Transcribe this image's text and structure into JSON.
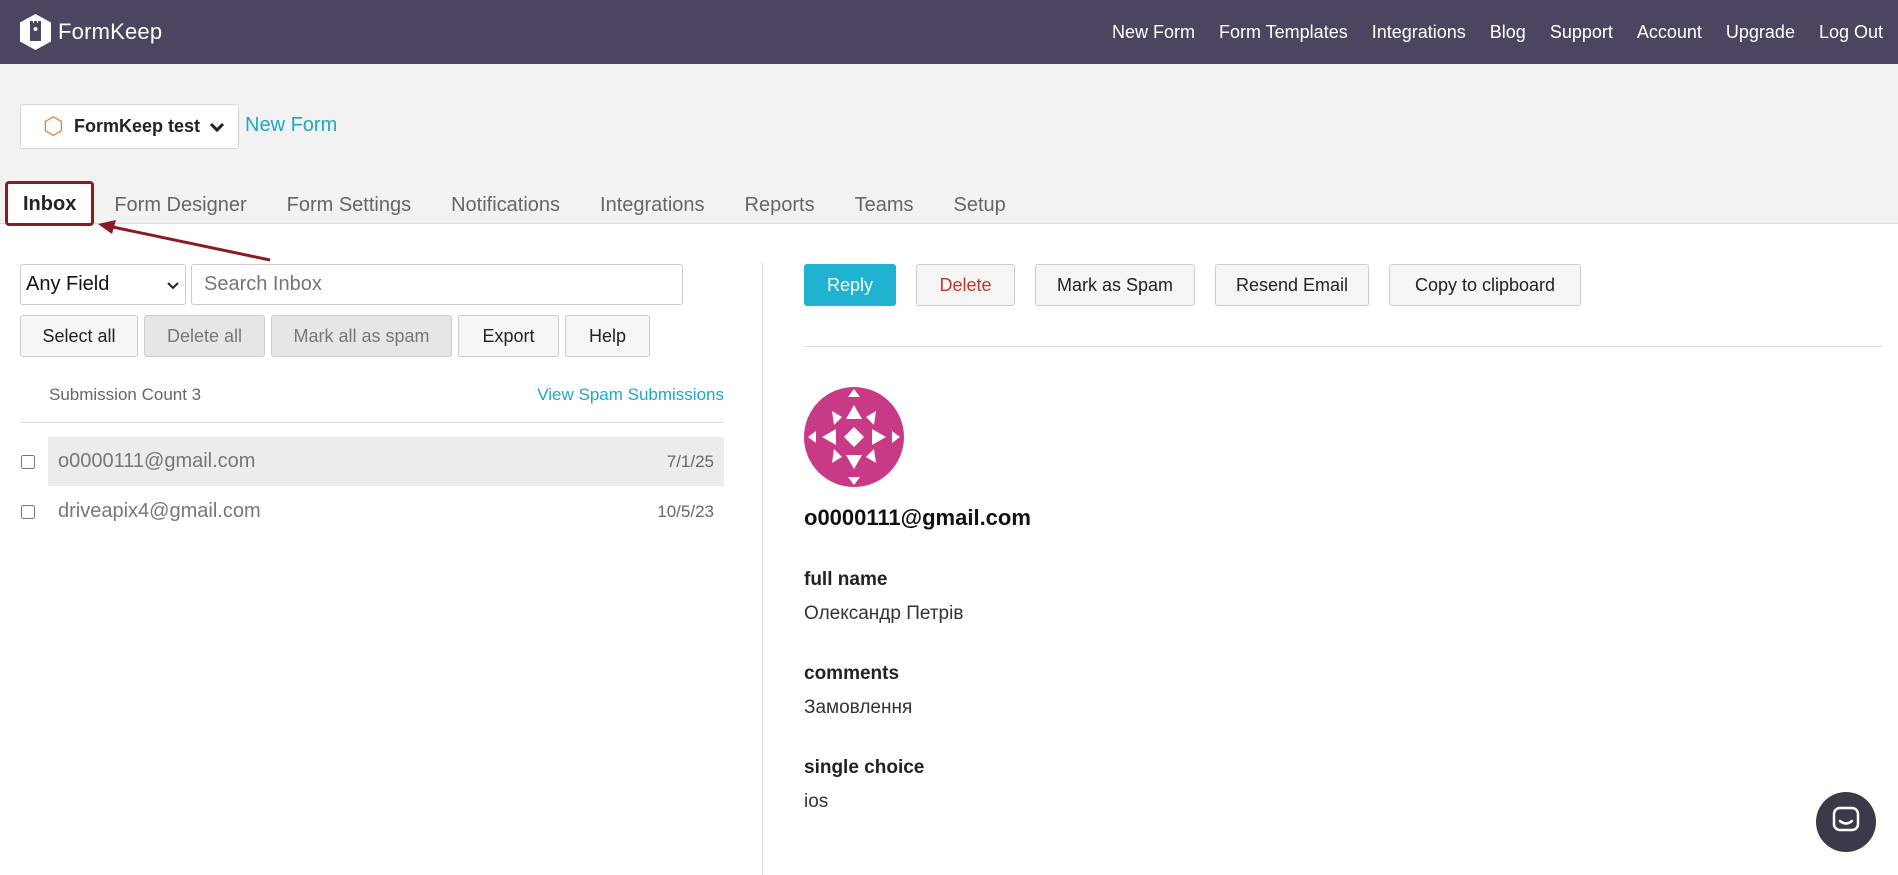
{
  "brand": {
    "name": "FormKeep"
  },
  "topnav": [
    "New Form",
    "Form Templates",
    "Integrations",
    "Blog",
    "Support",
    "Account",
    "Upgrade",
    "Log Out"
  ],
  "form_selector": {
    "name": "FormKeep test"
  },
  "new_form_link": "New Form",
  "tabs": [
    "Inbox",
    "Form Designer",
    "Form Settings",
    "Notifications",
    "Integrations",
    "Reports",
    "Teams",
    "Setup"
  ],
  "active_tab": "Inbox",
  "filter": {
    "selected": "Any Field",
    "search_placeholder": "Search Inbox"
  },
  "inbox_buttons": {
    "select_all": "Select all",
    "delete_all": "Delete all",
    "mark_all_spam": "Mark all as spam",
    "export": "Export",
    "help": "Help"
  },
  "submission_count_label": "Submission Count 3",
  "view_spam_link": "View Spam Submissions",
  "submissions": [
    {
      "email": "o0000111@gmail.com",
      "date": "7/1/25",
      "selected": true
    },
    {
      "email": "driveapix4@gmail.com",
      "date": "10/5/23",
      "selected": false
    }
  ],
  "detail_actions": {
    "reply": "Reply",
    "delete": "Delete",
    "mark_spam": "Mark as Spam",
    "resend": "Resend Email",
    "copy": "Copy to clipboard"
  },
  "detail": {
    "email": "o0000111@gmail.com",
    "fields": [
      {
        "label": "full name",
        "value": "Олександр Петрів"
      },
      {
        "label": "comments",
        "value": "Замовлення"
      },
      {
        "label": "single choice",
        "value": "ios"
      }
    ]
  },
  "colors": {
    "topbar": "#4d4560",
    "accent": "#1fb3d1",
    "annotation": "#8b1a22",
    "avatar": "#c93a86"
  }
}
